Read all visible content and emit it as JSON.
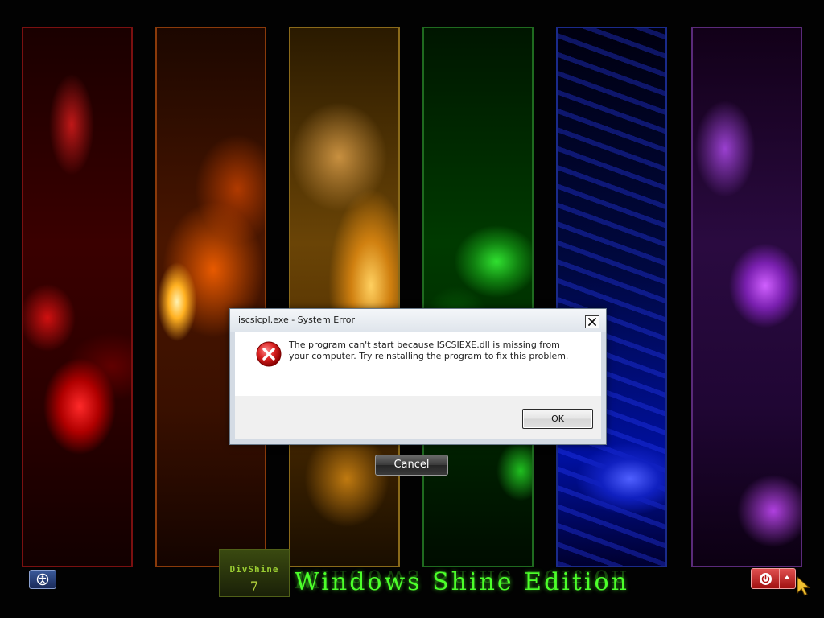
{
  "desktop": {
    "panels": [
      {
        "name": "red",
        "color": "#b00000"
      },
      {
        "name": "orange",
        "color": "#e85a00"
      },
      {
        "name": "yellow",
        "color": "#d08010"
      },
      {
        "name": "green",
        "color": "#108010"
      },
      {
        "name": "blue",
        "color": "#1020c0"
      },
      {
        "name": "purple",
        "color": "#7a20b0"
      }
    ],
    "brand_title": "Windows Shine Edition",
    "divshine_title": "DivShine",
    "divshine_version": "7",
    "brand_color": "#4cff2a"
  },
  "cancel_button": {
    "label": "Cancel"
  },
  "controls": {
    "ease_of_access_icon": "ease-of-access-icon",
    "shutdown_icon": "power-icon",
    "shutdown_arrow_icon": "arrow-up-icon",
    "shutdown_color": "#c02020"
  },
  "dialog": {
    "title": "iscsicpl.exe - System Error",
    "icon": "error-icon",
    "message": "The program can't start because ISCSIEXE.dll is missing from your computer. Try reinstalling the program to fix this problem.",
    "ok_label": "OK",
    "close_icon": "close-icon"
  }
}
